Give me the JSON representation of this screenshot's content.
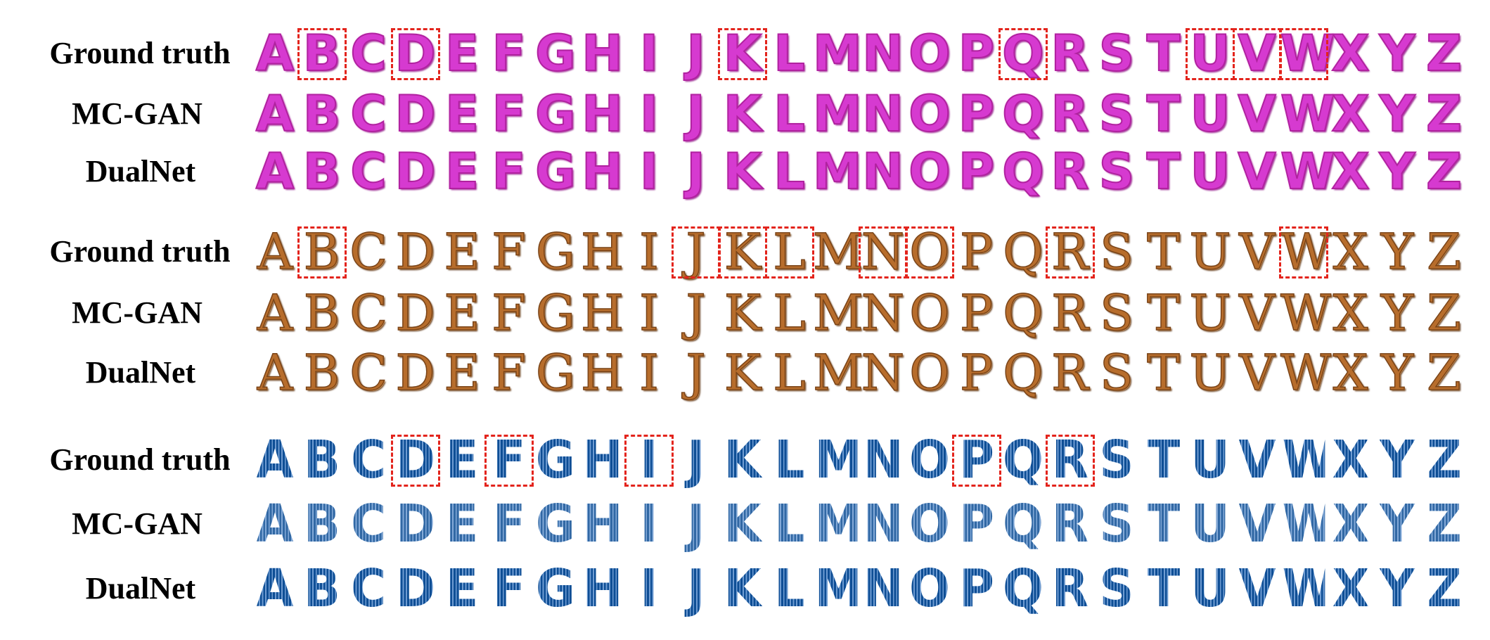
{
  "alphabet": [
    "A",
    "B",
    "C",
    "D",
    "E",
    "F",
    "G",
    "H",
    "I",
    "J",
    "K",
    "L",
    "M",
    "N",
    "O",
    "P",
    "Q",
    "R",
    "S",
    "T",
    "U",
    "V",
    "W",
    "X",
    "Y",
    "Z"
  ],
  "groups": [
    {
      "style": "pink",
      "color": "#d63ad0",
      "rows": [
        {
          "label": "Ground truth",
          "kind": "gt"
        },
        {
          "label": "MC-GAN",
          "kind": "mc"
        },
        {
          "label": "DualNet",
          "kind": "dn"
        }
      ],
      "highlighted": [
        "B",
        "D",
        "K",
        "Q",
        "U",
        "V",
        "W"
      ]
    },
    {
      "style": "bronze",
      "color": "#b76d2c",
      "rows": [
        {
          "label": "Ground truth",
          "kind": "gt"
        },
        {
          "label": "MC-GAN",
          "kind": "mc"
        },
        {
          "label": "DualNet",
          "kind": "dn"
        }
      ],
      "highlighted": [
        "B",
        "J",
        "K",
        "L",
        "N",
        "O",
        "R",
        "W"
      ]
    },
    {
      "style": "blue",
      "color": "#0e4e95",
      "rows": [
        {
          "label": "Ground truth",
          "kind": "gt"
        },
        {
          "label": "MC-GAN",
          "kind": "mc"
        },
        {
          "label": "DualNet",
          "kind": "dn"
        }
      ],
      "highlighted": [
        "D",
        "F",
        "I",
        "P",
        "R"
      ]
    }
  ]
}
